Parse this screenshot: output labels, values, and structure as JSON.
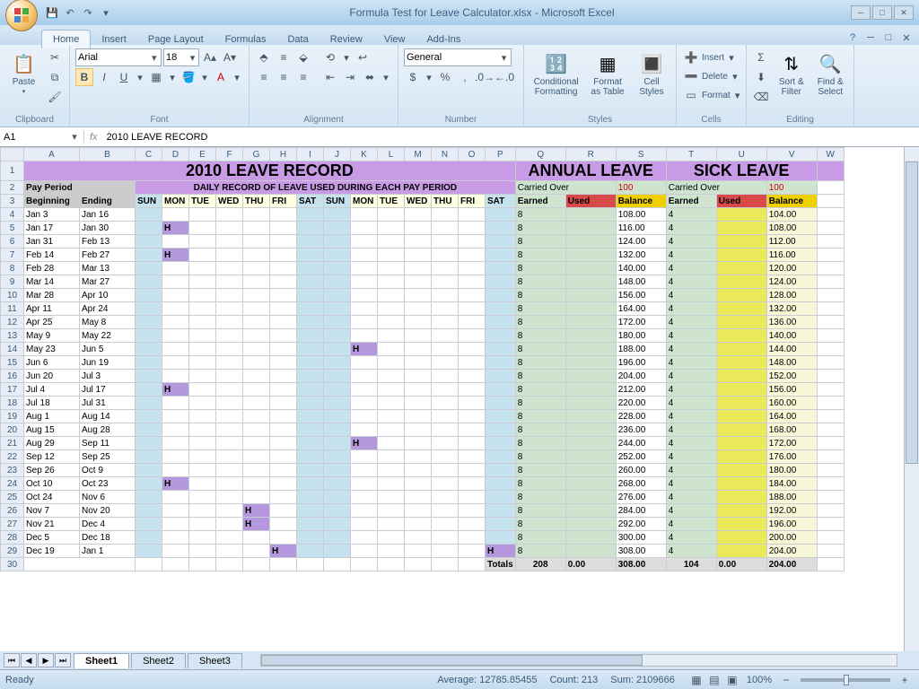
{
  "title": "Formula Test for Leave Calculator.xlsx - Microsoft Excel",
  "tabs": [
    "Home",
    "Insert",
    "Page Layout",
    "Formulas",
    "Data",
    "Review",
    "View",
    "Add-Ins"
  ],
  "activeTab": 0,
  "ribbon": {
    "clipboard": {
      "label": "Clipboard",
      "paste": "Paste"
    },
    "font": {
      "label": "Font",
      "name": "Arial",
      "size": "18"
    },
    "alignment": {
      "label": "Alignment"
    },
    "number": {
      "label": "Number",
      "format": "General"
    },
    "styles": {
      "label": "Styles",
      "cond": "Conditional\nFormatting",
      "fmt": "Format\nas Table",
      "cell": "Cell\nStyles"
    },
    "cells": {
      "label": "Cells",
      "insert": "Insert",
      "delete": "Delete",
      "format": "Format"
    },
    "editing": {
      "label": "Editing",
      "sort": "Sort &\nFilter",
      "find": "Find &\nSelect"
    }
  },
  "namebox": "A1",
  "formula": "2010 LEAVE RECORD",
  "columns": [
    "A",
    "B",
    "C",
    "D",
    "E",
    "F",
    "G",
    "H",
    "I",
    "J",
    "K",
    "L",
    "M",
    "N",
    "O",
    "P",
    "Q",
    "R",
    "S",
    "T",
    "U",
    "V",
    "W"
  ],
  "sheet": {
    "title": "2010 LEAVE RECORD",
    "subtitle": "DAILY RECORD OF LEAVE USED DURING EACH PAY PERIOD",
    "payperiod": "Pay Period",
    "beg": "Beginning",
    "end": "Ending",
    "days": [
      "SUN",
      "MON",
      "TUE",
      "WED",
      "THU",
      "FRI",
      "SAT",
      "SUN",
      "MON",
      "TUE",
      "WED",
      "THU",
      "FRI",
      "SAT"
    ],
    "annual": "ANNUAL LEAVE",
    "sick": "SICK LEAVE",
    "carried": "Carried Over",
    "carriedVal": "100",
    "earned": "Earned",
    "used": "Used",
    "balance": "Balance",
    "rows": [
      {
        "r": 4,
        "b": "Jan 3",
        "e": "Jan 16",
        "h": [],
        "ae": "8",
        "ab": "108.00",
        "se": "4",
        "sb": "104.00"
      },
      {
        "r": 5,
        "b": "Jan 17",
        "e": "Jan 30",
        "h": [
          1
        ],
        "ae": "8",
        "ab": "116.00",
        "se": "4",
        "sb": "108.00"
      },
      {
        "r": 6,
        "b": "Jan 31",
        "e": "Feb 13",
        "h": [],
        "ae": "8",
        "ab": "124.00",
        "se": "4",
        "sb": "112.00"
      },
      {
        "r": 7,
        "b": "Feb 14",
        "e": "Feb 27",
        "h": [
          1
        ],
        "ae": "8",
        "ab": "132.00",
        "se": "4",
        "sb": "116.00"
      },
      {
        "r": 8,
        "b": "Feb 28",
        "e": "Mar 13",
        "h": [],
        "ae": "8",
        "ab": "140.00",
        "se": "4",
        "sb": "120.00"
      },
      {
        "r": 9,
        "b": "Mar 14",
        "e": "Mar 27",
        "h": [],
        "ae": "8",
        "ab": "148.00",
        "se": "4",
        "sb": "124.00"
      },
      {
        "r": 10,
        "b": "Mar 28",
        "e": "Apr 10",
        "h": [],
        "ae": "8",
        "ab": "156.00",
        "se": "4",
        "sb": "128.00"
      },
      {
        "r": 11,
        "b": "Apr 11",
        "e": "Apr 24",
        "h": [],
        "ae": "8",
        "ab": "164.00",
        "se": "4",
        "sb": "132.00"
      },
      {
        "r": 12,
        "b": "Apr 25",
        "e": "May 8",
        "h": [],
        "ae": "8",
        "ab": "172.00",
        "se": "4",
        "sb": "136.00"
      },
      {
        "r": 13,
        "b": "May 9",
        "e": "May 22",
        "h": [],
        "ae": "8",
        "ab": "180.00",
        "se": "4",
        "sb": "140.00"
      },
      {
        "r": 14,
        "b": "May 23",
        "e": "Jun 5",
        "h": [
          8
        ],
        "ae": "8",
        "ab": "188.00",
        "se": "4",
        "sb": "144.00"
      },
      {
        "r": 15,
        "b": "Jun 6",
        "e": "Jun 19",
        "h": [],
        "ae": "8",
        "ab": "196.00",
        "se": "4",
        "sb": "148.00"
      },
      {
        "r": 16,
        "b": "Jun 20",
        "e": "Jul 3",
        "h": [],
        "ae": "8",
        "ab": "204.00",
        "se": "4",
        "sb": "152.00"
      },
      {
        "r": 17,
        "b": "Jul 4",
        "e": "Jul 17",
        "h": [
          1
        ],
        "ae": "8",
        "ab": "212.00",
        "se": "4",
        "sb": "156.00"
      },
      {
        "r": 18,
        "b": "Jul 18",
        "e": "Jul 31",
        "h": [],
        "ae": "8",
        "ab": "220.00",
        "se": "4",
        "sb": "160.00"
      },
      {
        "r": 19,
        "b": "Aug 1",
        "e": "Aug 14",
        "h": [],
        "ae": "8",
        "ab": "228.00",
        "se": "4",
        "sb": "164.00"
      },
      {
        "r": 20,
        "b": "Aug 15",
        "e": "Aug 28",
        "h": [],
        "ae": "8",
        "ab": "236.00",
        "se": "4",
        "sb": "168.00"
      },
      {
        "r": 21,
        "b": "Aug 29",
        "e": "Sep 11",
        "h": [
          8
        ],
        "ae": "8",
        "ab": "244.00",
        "se": "4",
        "sb": "172.00"
      },
      {
        "r": 22,
        "b": "Sep 12",
        "e": "Sep 25",
        "h": [],
        "ae": "8",
        "ab": "252.00",
        "se": "4",
        "sb": "176.00"
      },
      {
        "r": 23,
        "b": "Sep 26",
        "e": "Oct 9",
        "h": [],
        "ae": "8",
        "ab": "260.00",
        "se": "4",
        "sb": "180.00"
      },
      {
        "r": 24,
        "b": "Oct 10",
        "e": "Oct 23",
        "h": [
          1
        ],
        "ae": "8",
        "ab": "268.00",
        "se": "4",
        "sb": "184.00"
      },
      {
        "r": 25,
        "b": "Oct 24",
        "e": "Nov 6",
        "h": [],
        "ae": "8",
        "ab": "276.00",
        "se": "4",
        "sb": "188.00"
      },
      {
        "r": 26,
        "b": "Nov 7",
        "e": "Nov 20",
        "h": [
          4
        ],
        "ae": "8",
        "ab": "284.00",
        "se": "4",
        "sb": "192.00"
      },
      {
        "r": 27,
        "b": "Nov 21",
        "e": "Dec 4",
        "h": [
          4
        ],
        "ae": "8",
        "ab": "292.00",
        "se": "4",
        "sb": "196.00"
      },
      {
        "r": 28,
        "b": "Dec 5",
        "e": "Dec 18",
        "h": [],
        "ae": "8",
        "ab": "300.00",
        "se": "4",
        "sb": "200.00"
      },
      {
        "r": 29,
        "b": "Dec 19",
        "e": "Jan 1",
        "h": [
          5,
          13
        ],
        "ae": "8",
        "ab": "308.00",
        "se": "4",
        "sb": "204.00"
      }
    ],
    "totals": {
      "label": "Totals",
      "ae": "208",
      "au": "0.00",
      "ab": "308.00",
      "se": "104",
      "su": "0.00",
      "sb": "204.00"
    }
  },
  "sheets": [
    "Sheet1",
    "Sheet2",
    "Sheet3"
  ],
  "activeSheet": 0,
  "status": {
    "ready": "Ready",
    "avg": "Average: 12785.85455",
    "count": "Count: 213",
    "sum": "Sum: 2109666",
    "zoom": "100%"
  }
}
